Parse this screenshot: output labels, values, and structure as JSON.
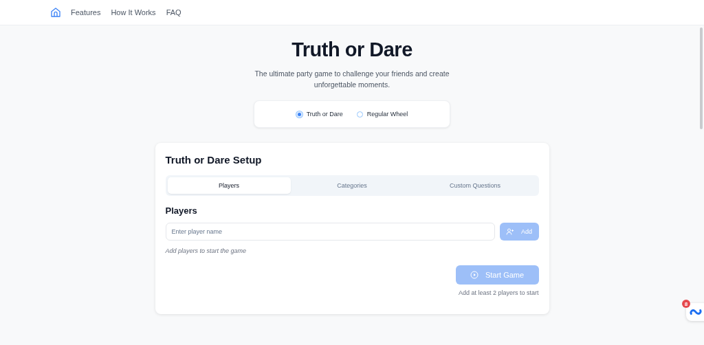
{
  "nav": {
    "links": [
      "Features",
      "How It Works",
      "FAQ"
    ]
  },
  "hero": {
    "title": "Truth or Dare",
    "subtitle": "The ultimate party game to challenge your friends and create unforgettable moments."
  },
  "modes": [
    {
      "label": "Truth or Dare",
      "selected": true
    },
    {
      "label": "Regular Wheel",
      "selected": false
    }
  ],
  "setup": {
    "title": "Truth or Dare Setup",
    "tabs": [
      {
        "label": "Players",
        "selected": true
      },
      {
        "label": "Categories",
        "selected": false
      },
      {
        "label": "Custom Questions",
        "selected": false
      }
    ],
    "section_title": "Players",
    "player_field": {
      "placeholder": "Enter player name"
    },
    "add_button": {
      "label": "Add",
      "disabled": true
    },
    "empty_hint": "Add players to start the game",
    "start_button": {
      "label": "Start Game",
      "disabled": true
    },
    "start_hint": "Add at least 2 players to start"
  },
  "widget": {
    "badge": "8"
  }
}
